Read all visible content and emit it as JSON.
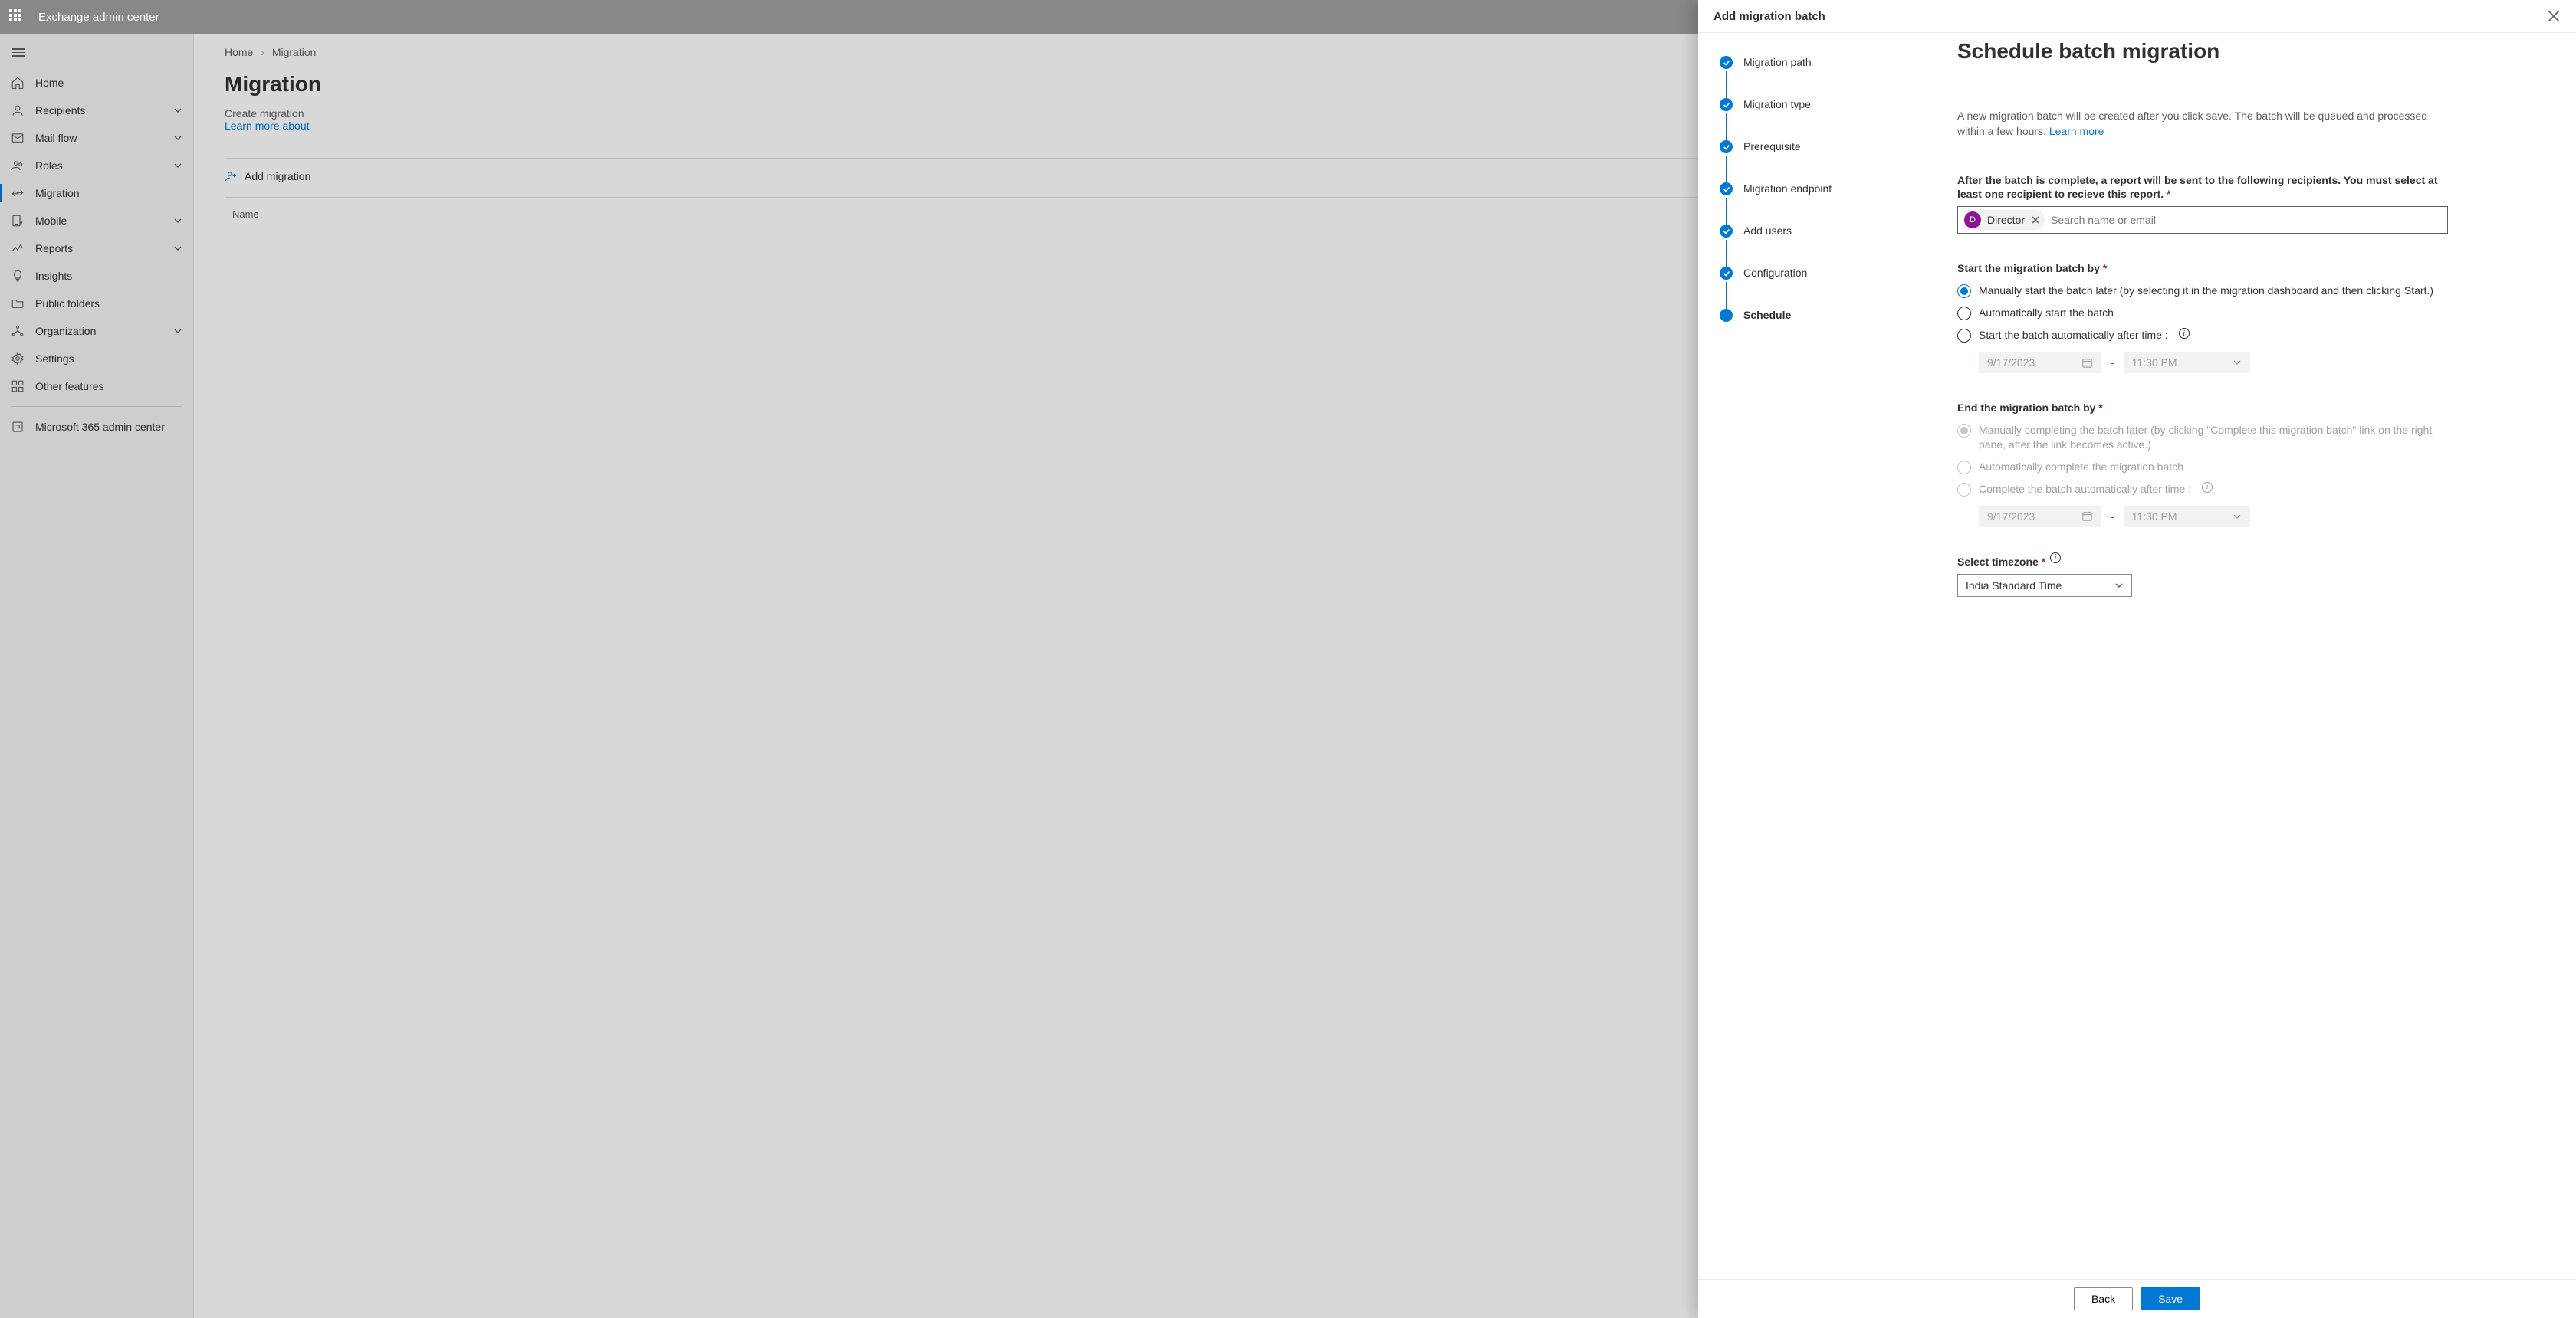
{
  "topbar": {
    "title": "Exchange admin center"
  },
  "sidebar": {
    "items": [
      {
        "label": "Home",
        "icon": "home"
      },
      {
        "label": "Recipients",
        "icon": "person",
        "expandable": true
      },
      {
        "label": "Mail flow",
        "icon": "mail",
        "expandable": true
      },
      {
        "label": "Roles",
        "icon": "roles",
        "expandable": true
      },
      {
        "label": "Migration",
        "icon": "migration",
        "active": true
      },
      {
        "label": "Mobile",
        "icon": "mobile",
        "expandable": true
      },
      {
        "label": "Reports",
        "icon": "reports",
        "expandable": true
      },
      {
        "label": "Insights",
        "icon": "bulb"
      },
      {
        "label": "Public folders",
        "icon": "folder"
      },
      {
        "label": "Organization",
        "icon": "org",
        "expandable": true
      },
      {
        "label": "Settings",
        "icon": "gear"
      },
      {
        "label": "Other features",
        "icon": "grid"
      }
    ],
    "footer_link": "Microsoft 365 admin center"
  },
  "breadcrumb": {
    "root": "Home",
    "current": "Migration"
  },
  "page": {
    "heading": "Migration",
    "desc_prefix": "Create migration",
    "learn_more": "Learn more about",
    "add_batch": "Add migration",
    "col_name": "Name"
  },
  "panel": {
    "title": "Add migration batch",
    "steps": [
      "Migration path",
      "Migration type",
      "Prerequisite",
      "Migration endpoint",
      "Add users",
      "Configuration",
      "Schedule"
    ],
    "current_step_index": 6,
    "form": {
      "title": "Schedule batch migration",
      "intro": "A new migration batch will be created after you click save. The batch will be queued and processed within a few hours.",
      "learn_more": "Learn more",
      "recipient_label": "After the batch is complete, a report will be sent to the following recipients. You must select at least one recipient to recieve this report.",
      "recipient_chip": {
        "initial": "D",
        "name": "Director"
      },
      "recipient_placeholder": "Search name or email",
      "start_label": "Start the migration batch by",
      "start_options": [
        "Manually start the batch later (by selecting it in the migration dashboard and then clicking Start.)",
        "Automatically start the batch",
        "Start the batch automatically after time :"
      ],
      "start_selected": 0,
      "start_date": "9/17/2023",
      "start_time": "11:30 PM",
      "end_label": "End the migration batch by",
      "end_options": [
        "Manually completing the batch later (by clicking \"Complete this migration batch\" link on the right pane, after the link becomes active.)",
        "Automatically complete the migration batch",
        "Complete the batch automatically after time :"
      ],
      "end_selected": 0,
      "end_date": "9/17/2023",
      "end_time": "11:30 PM",
      "tz_label": "Select timezone",
      "tz_value": "India Standard Time"
    },
    "buttons": {
      "back": "Back",
      "save": "Save"
    }
  }
}
